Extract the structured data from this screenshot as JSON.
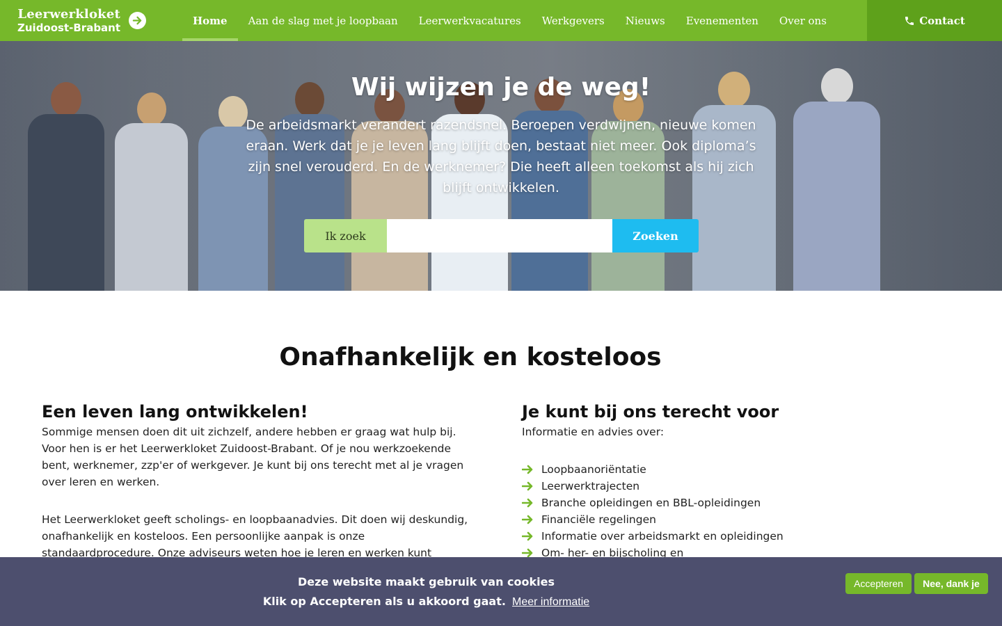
{
  "header": {
    "logo_line1": "Leerwerkloket",
    "logo_line2": "Zuidoost-Brabant",
    "logo_icon": "arrow-right-circle-icon",
    "nav": [
      {
        "label": "Home",
        "active": true
      },
      {
        "label": "Aan de slag met je loopbaan"
      },
      {
        "label": "Leerwerkvacatures"
      },
      {
        "label": "Werkgevers"
      },
      {
        "label": "Nieuws"
      },
      {
        "label": "Evenementen"
      },
      {
        "label": "Over ons"
      }
    ],
    "contact_label": "Contact",
    "contact_icon": "phone-icon"
  },
  "hero": {
    "title": "Wij wijzen je de weg!",
    "text": "De arbeidsmarkt verandert razendsnel. Beroepen verdwijnen, nieuwe komen eraan. Werk dat je je leven lang blijft doen, bestaat niet meer. Ook diploma’s zijn snel verouderd. En de werknemer? Die heeft alleen toekomst als hij zich blijft ontwikkelen.",
    "search_label": "Ik zoek",
    "search_value": "",
    "search_button": "Zoeken"
  },
  "main": {
    "title": "Onafhankelijk en kosteloos",
    "left": {
      "heading": "Een leven lang ontwikkelen!",
      "p1": "Sommige mensen doen dit uit zichzelf, andere hebben er graag wat hulp bij. Voor hen is er het Leerwerkloket Zuidoost-Brabant. Of je nou werkzoekende bent, werknemer, zzp'er of werkgever. Je kunt bij ons terecht met al je vragen over leren en werken.",
      "p2": "Het Leerwerkloket geeft scholings- en loopbaanadvies. Dit doen wij deskundig, onafhankelijk en kosteloos.  Een persoonlijke aanpak is onze standaardprocedure. Onze adviseurs weten hoe je leren en werken kunt combineren. Het Leerwerkloket"
    },
    "right": {
      "heading": "Je kunt bij ons terecht voor",
      "intro": "Informatie en advies over:",
      "items": [
        "Loopbaanoriëntatie",
        "Leerwerktrajecten",
        "Branche opleidingen en BBL-opleidingen",
        "Financiële regelingen",
        "Informatie over arbeidsmarkt en opleidingen",
        "Om- her- en bijscholing en"
      ],
      "item_icon": "arrow-right-icon"
    }
  },
  "cookie": {
    "line1": "Deze website maakt gebruik van cookies",
    "line2": "Klik op Accepteren als u akkoord gaat.",
    "link": "Meer informatie",
    "accept": "Accepteren",
    "decline": "Nee, dank je"
  },
  "colors": {
    "brand_green": "#76b82a",
    "contact_green": "#5ea11b",
    "search_label_bg": "#b9e28a",
    "search_button_bg": "#1ebcf0",
    "cookie_bg": "#4d4f6e"
  }
}
